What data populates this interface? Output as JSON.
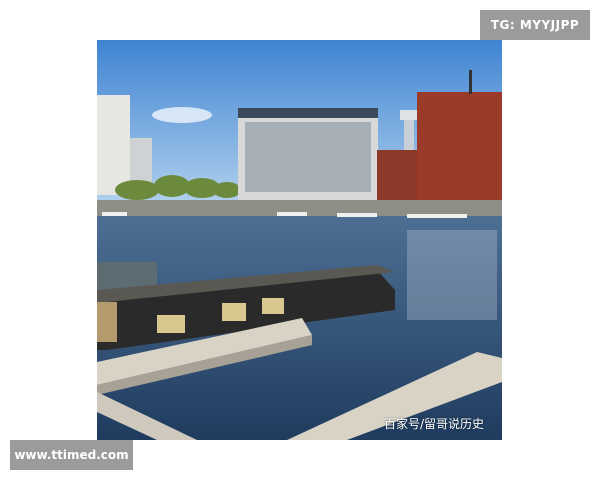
{
  "watermarks": {
    "top_right": "TG: MYYJJPP",
    "bottom_left": "www.ttimed.com",
    "photo_caption": "百家号/留哥说历史"
  },
  "scene": {
    "description_icon": "harbor-photo",
    "colors": {
      "sky_top": "#4f8fd6",
      "sky_bottom": "#a9ccec",
      "water": "#2b4f78",
      "brick": "#9a3b2a",
      "boat_hull": "#2a2a2a",
      "pontoon": "#d9d3c6"
    }
  }
}
